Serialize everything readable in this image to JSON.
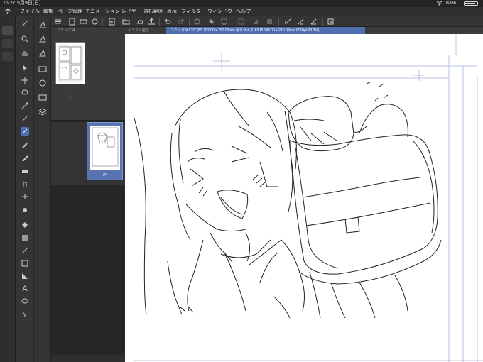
{
  "status": {
    "time": "16:27",
    "date": "5月9日(日)",
    "battery": "83%",
    "wifi": "wifi-icon"
  },
  "menu": {
    "items": [
      "ファイル",
      "編集",
      "ページ管理",
      "アニメーション",
      "レイヤー",
      "選択範囲",
      "表示",
      "フィルター",
      "ウィンドウ",
      "ヘルプ"
    ]
  },
  "pages_panel": {
    "tab_label": "コミック34",
    "page1_number": "1",
    "page2_number": "2*"
  },
  "canvas": {
    "tab_inactive": "イラスト描き",
    "tab_active": "コミック34* 2/2 (B5 182.00 x 257.00mm 製本サイズ:A5 Pl.148.00 x 210.00mm 600dpi 63.3%)"
  },
  "colors": {
    "accent": "#4f6fb1",
    "selected_page": "#5774b0"
  }
}
